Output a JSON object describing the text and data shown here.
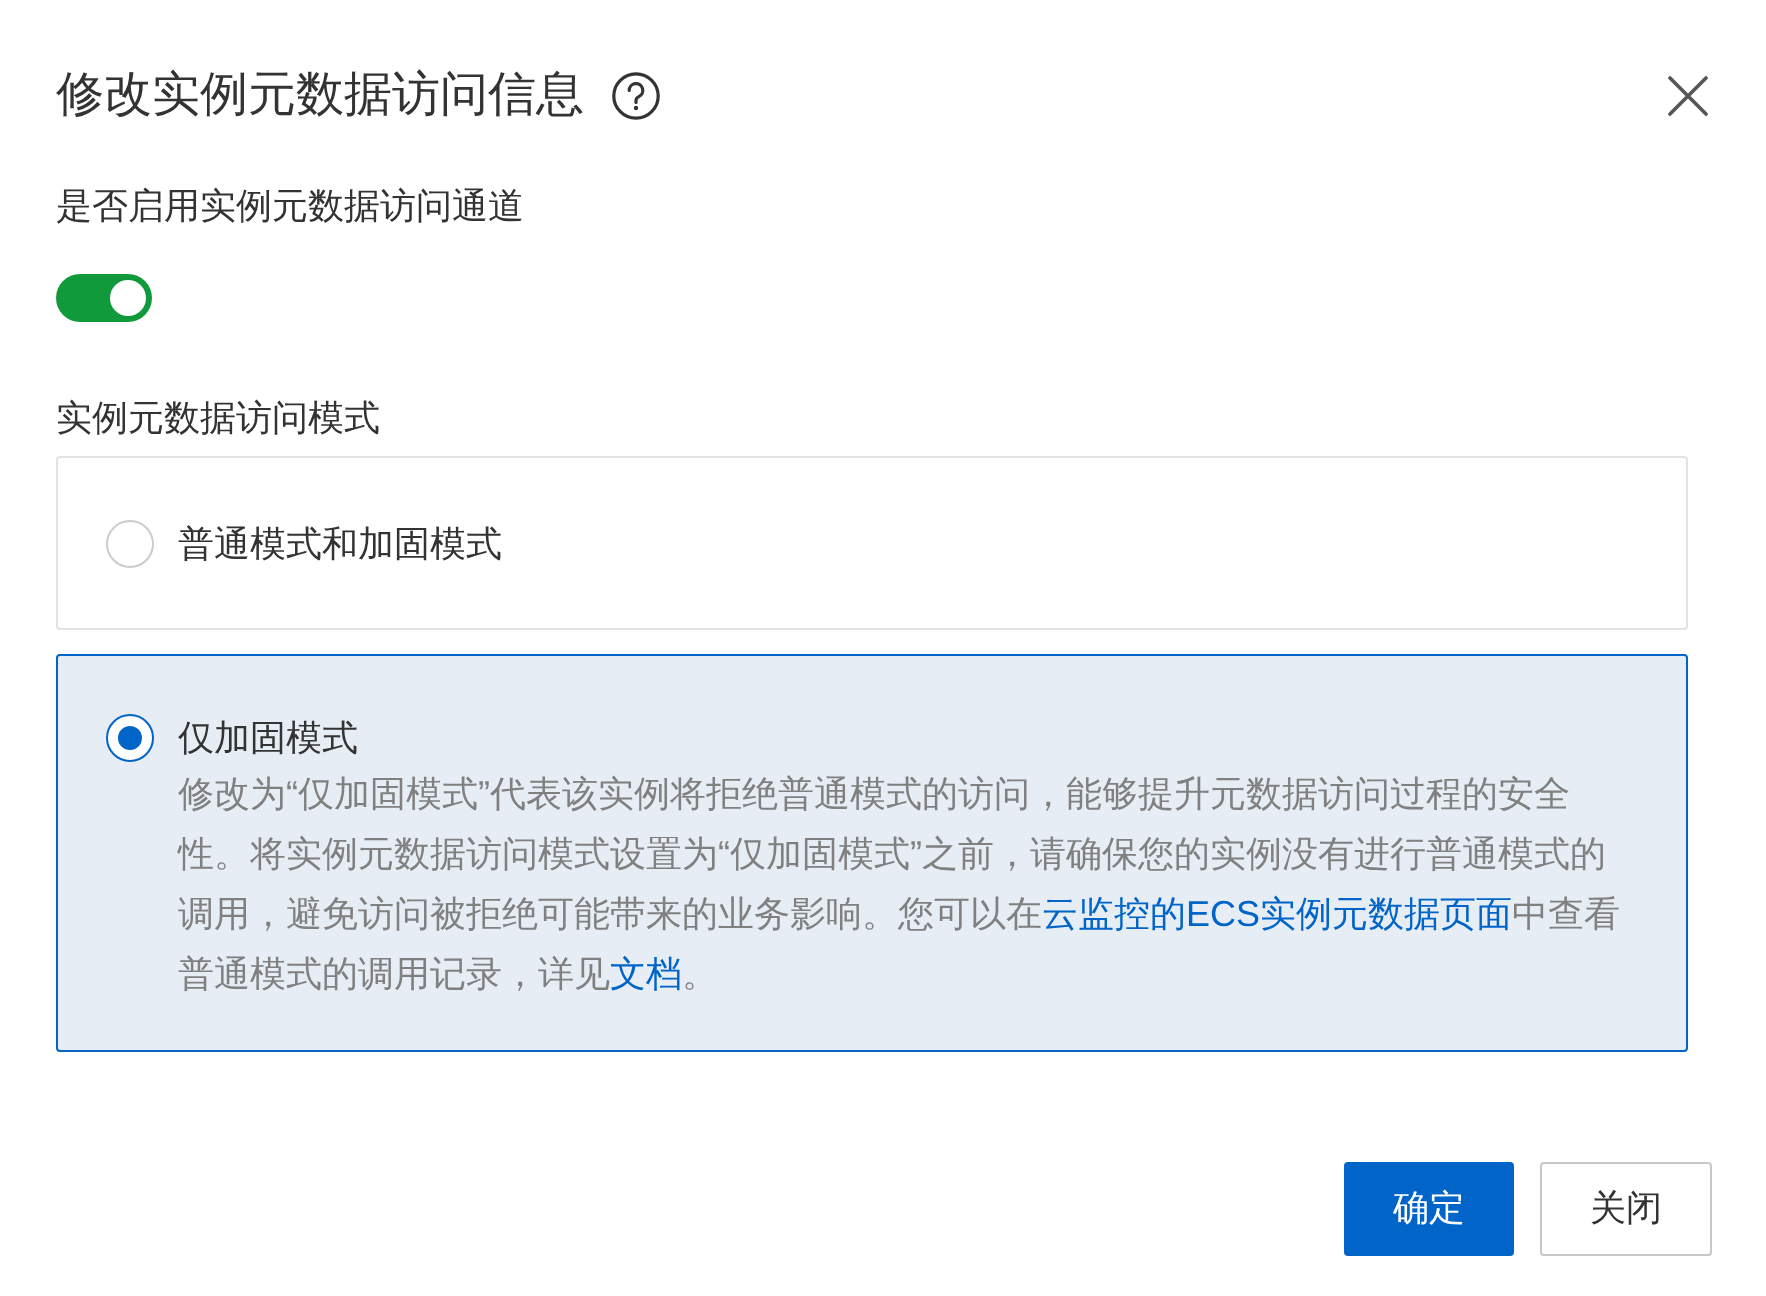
{
  "dialog": {
    "title": "修改实例元数据访问信息"
  },
  "enable_channel": {
    "label": "是否启用实例元数据访问通道",
    "on": true
  },
  "access_mode": {
    "label": "实例元数据访问模式",
    "options": [
      {
        "title": "普通模式和加固模式",
        "selected": false
      },
      {
        "title": "仅加固模式",
        "selected": true,
        "description": [
          {
            "kind": "text",
            "text": "修改为“仅加固模式”代表该实例将拒绝普通模式的访问，能够提升元数据访问过程的安全性。将实例元数据访问模式设置为“仅加固模式”之前，请确保您的实例没有进行普通模式的调用，避免访问被拒绝可能带来的业务影响。您可以在"
          },
          {
            "kind": "link",
            "text": "云监控的ECS实例元数据页面"
          },
          {
            "kind": "text",
            "text": "中查看普通模式的调用记录，详见"
          },
          {
            "kind": "link",
            "text": "文档"
          },
          {
            "kind": "text",
            "text": "。"
          }
        ]
      }
    ]
  },
  "buttons": [
    {
      "label": "确定",
      "kind": "primary"
    },
    {
      "label": "关闭",
      "kind": "secondary"
    }
  ]
}
